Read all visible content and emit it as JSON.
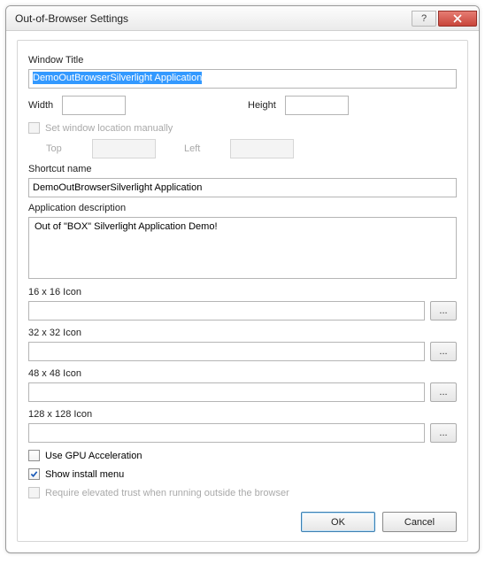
{
  "titlebar": {
    "title": "Out-of-Browser Settings"
  },
  "labels": {
    "windowTitle": "Window Title",
    "width": "Width",
    "height": "Height",
    "setLoc": "Set window location manually",
    "top": "Top",
    "left": "Left",
    "shortcut": "Shortcut name",
    "appDesc": "Application description",
    "icon16": "16 x 16 Icon",
    "icon32": "32 x 32 Icon",
    "icon48": "48 x 48 Icon",
    "icon128": "128 x 128 Icon",
    "gpu": "Use GPU Acceleration",
    "install": "Show install menu",
    "elevated": "Require elevated trust when running outside the browser"
  },
  "values": {
    "windowTitle": "DemoOutBrowserSilverlight Application",
    "width": "",
    "height": "",
    "top": "",
    "left": "",
    "shortcut": "DemoOutBrowserSilverlight Application",
    "appDesc": "Out of \"BOX\" Silverlight Application Demo!",
    "icon16": "",
    "icon32": "",
    "icon48": "",
    "icon128": "",
    "gpu": false,
    "install": true,
    "elevated": false,
    "setLoc": false
  },
  "buttons": {
    "browse": "...",
    "ok": "OK",
    "cancel": "Cancel",
    "help": "?"
  }
}
